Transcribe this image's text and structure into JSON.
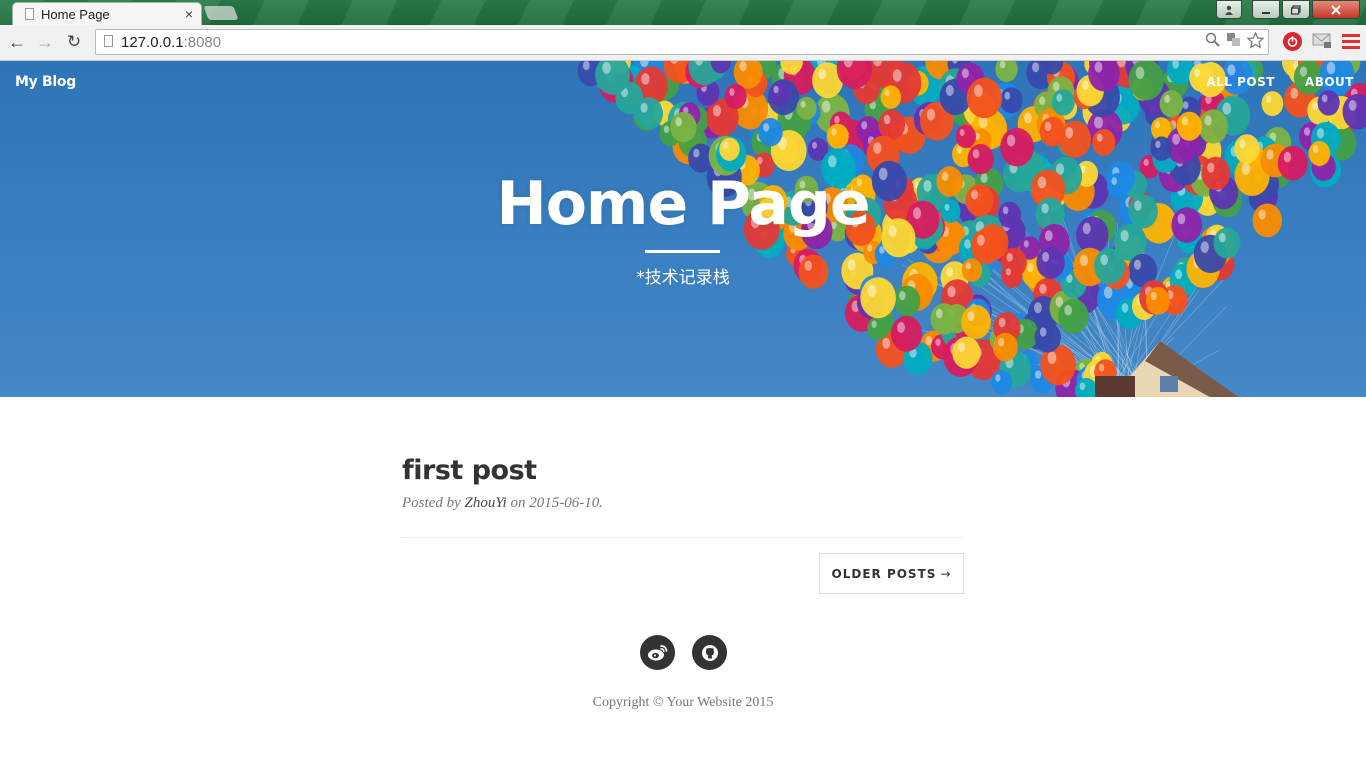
{
  "browser": {
    "tab_title": "Home Page",
    "tab_close": "×",
    "url_host": "127.0.0.1",
    "url_port": ":8080",
    "back_glyph": "←",
    "forward_glyph": "→",
    "reload_glyph": "↻"
  },
  "nav": {
    "brand": "My Blog",
    "links": [
      "ALL POST",
      "ABOUT"
    ]
  },
  "hero": {
    "title": "Home Page",
    "subtitle": "*技术记录栈"
  },
  "post": {
    "title": "first post",
    "meta_prefix": "Posted by",
    "author": "ZhouYi",
    "meta_on": "on",
    "date": "2015-06-10."
  },
  "pager": {
    "older_label": "OLDER POSTS",
    "older_arrow": "→"
  },
  "social": {
    "icons": [
      "weibo-icon",
      "github-icon"
    ]
  },
  "footer": {
    "copyright": "Copyright © Your Website 2015"
  },
  "colors": {
    "sky": "#3a80c2",
    "text_dark": "#333333",
    "accent_red": "#d9272e"
  }
}
